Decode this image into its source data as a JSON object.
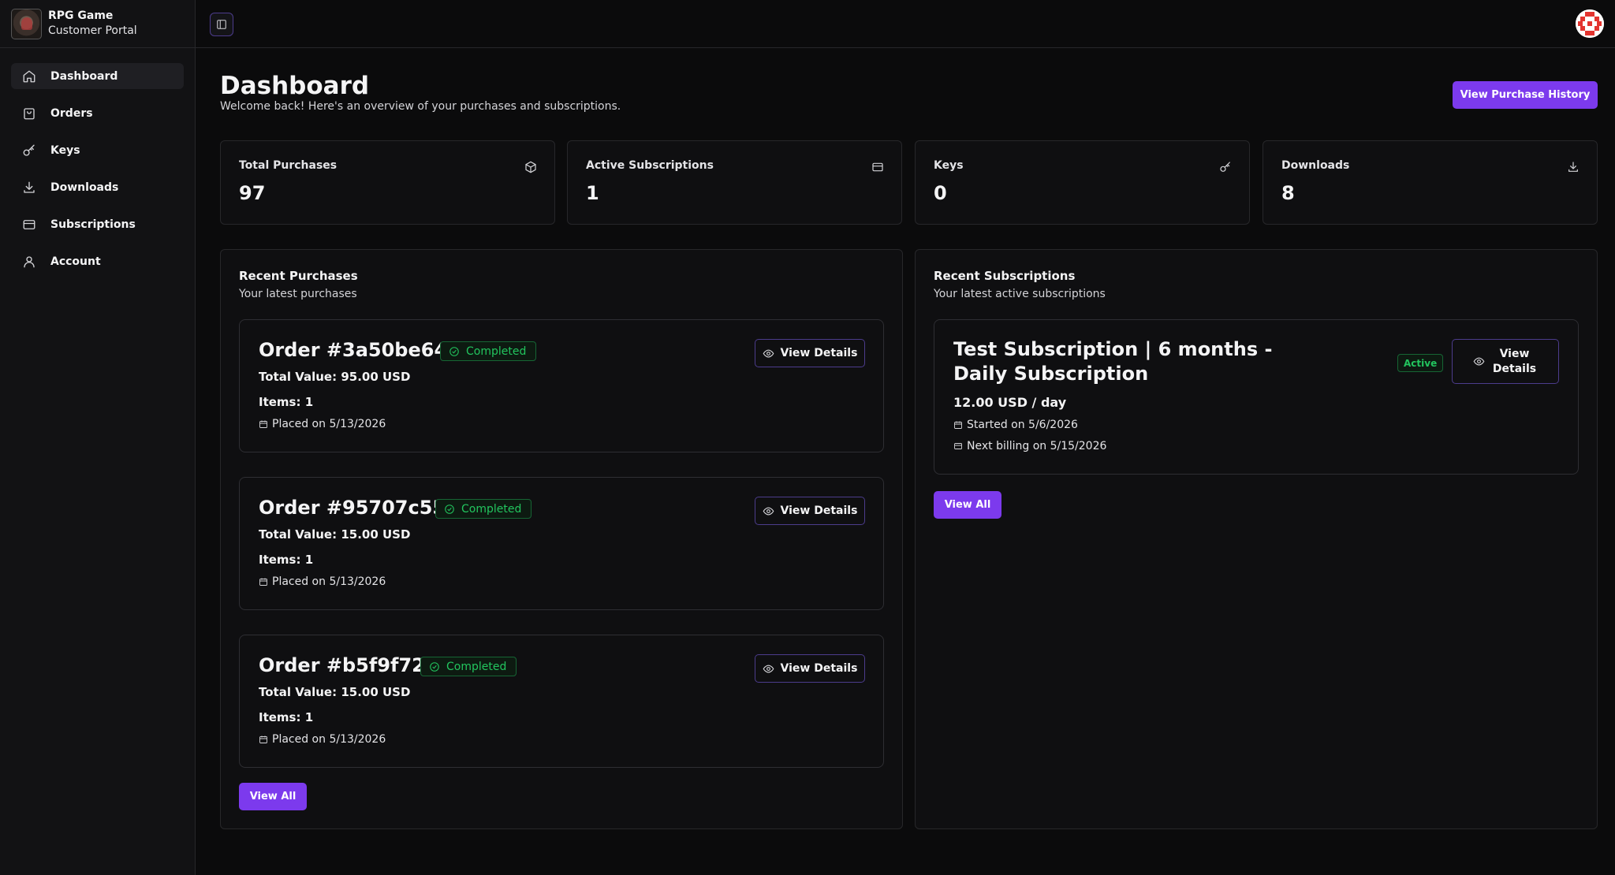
{
  "brand": {
    "title": "RPG Game",
    "subtitle": "Customer Portal"
  },
  "sidebar": {
    "items": [
      {
        "label": "Dashboard",
        "icon": "home-icon",
        "active": true
      },
      {
        "label": "Orders",
        "icon": "shopping-bag-icon"
      },
      {
        "label": "Keys",
        "icon": "key-icon"
      },
      {
        "label": "Downloads",
        "icon": "download-icon"
      },
      {
        "label": "Subscriptions",
        "icon": "credit-card-icon"
      },
      {
        "label": "Account",
        "icon": "user-icon"
      }
    ]
  },
  "header": {
    "title": "Dashboard",
    "subtitle": "Welcome back! Here's an overview of your purchases and subscriptions.",
    "history_button": "View Purchase History"
  },
  "stats": [
    {
      "label": "Total Purchases",
      "value": "97",
      "icon": "package-icon"
    },
    {
      "label": "Active Subscriptions",
      "value": "1",
      "icon": "credit-card-icon"
    },
    {
      "label": "Keys",
      "value": "0",
      "icon": "key-icon"
    },
    {
      "label": "Downloads",
      "value": "8",
      "icon": "download-icon"
    }
  ],
  "recent_purchases": {
    "title": "Recent Purchases",
    "subtitle": "Your latest purchases",
    "view_all": "View All",
    "orders": [
      {
        "title": "Order #3a50be64",
        "status": "Completed",
        "total": "Total Value: 95.00 USD",
        "items": "Items: 1",
        "placed": "Placed on 5/13/2026",
        "button": "View Details"
      },
      {
        "title": "Order #95707c55",
        "status": "Completed",
        "total": "Total Value: 15.00 USD",
        "items": "Items: 1",
        "placed": "Placed on 5/13/2026",
        "button": "View Details"
      },
      {
        "title": "Order #b5f9f721",
        "status": "Completed",
        "total": "Total Value: 15.00 USD",
        "items": "Items: 1",
        "placed": "Placed on 5/13/2026",
        "button": "View Details"
      }
    ]
  },
  "recent_subscriptions": {
    "title": "Recent Subscriptions",
    "subtitle": "Your latest active subscriptions",
    "view_all": "View All",
    "subscriptions": [
      {
        "title": "Test Subscription | 6 months - Daily Subscription",
        "status": "Active",
        "price": "12.00 USD / day",
        "started": "Started on 5/6/2026",
        "next_billing": "Next billing on 5/15/2026",
        "button": "View Details"
      }
    ]
  },
  "colors": {
    "accent": "#7c3aed",
    "success": "#22c55e",
    "background": "#0b0b0c",
    "border": "#27272a"
  }
}
